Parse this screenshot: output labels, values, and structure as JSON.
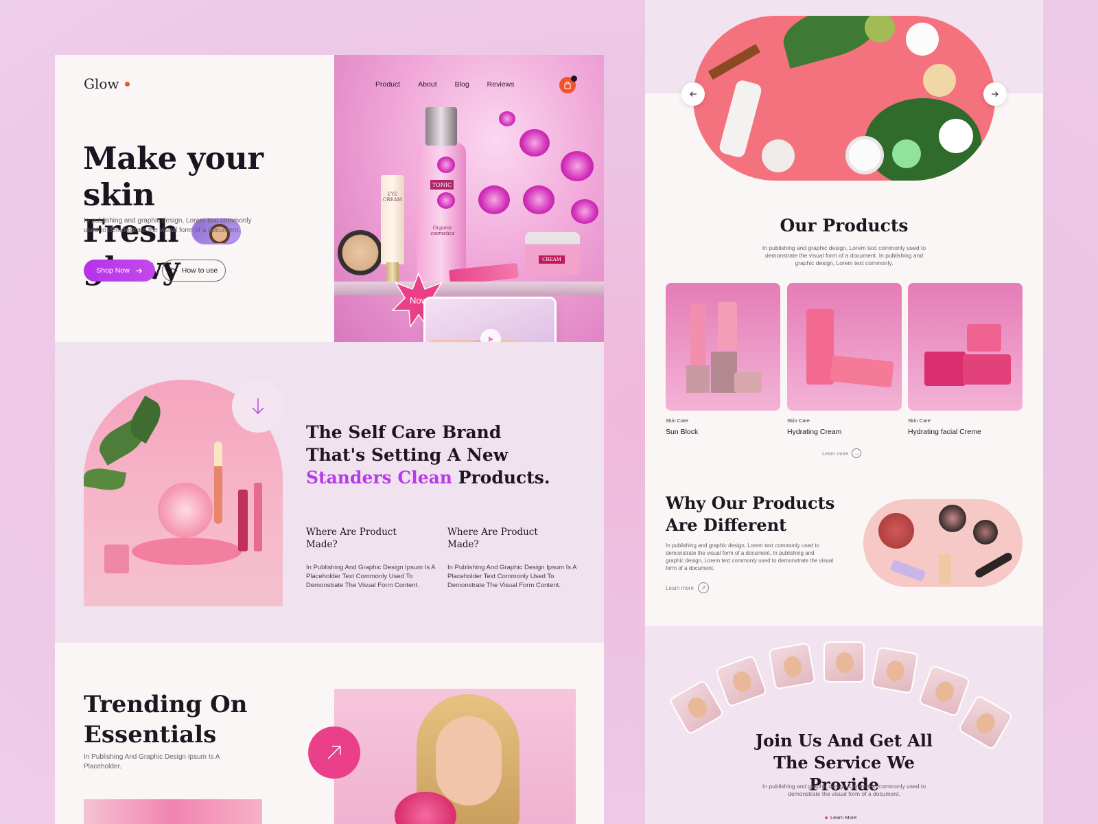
{
  "brand": {
    "name": "Glow"
  },
  "nav": {
    "items": [
      "Product",
      "About",
      "Blog",
      "Reviews"
    ],
    "cart_count": ""
  },
  "hero": {
    "title_line1": "Make your skin",
    "title_line2a": "Fresh",
    "title_line2b": "glowy",
    "description": "In publishing and graphic design, Lorem text commonly used to demonstrate the visual form of a document.",
    "shop_label": "Shop Now",
    "how_label": "How to use",
    "star_label": "Now",
    "product_labels": {
      "tonic": "TONIC",
      "eye_cream": "EYE CREAM",
      "cream": "CREAM",
      "organic": "Organic cosmetics"
    }
  },
  "selfcare": {
    "title_a": "The Self Care Brand That's Setting A New ",
    "title_accent": "Standers Clean",
    "title_b": " Products.",
    "columns": [
      {
        "heading": "Where Are Product Made?",
        "text": "In Publishing And Graphic Design Ipsum Is A Placeholder Text Commonly Used To Demonstrate The Visual Form Content."
      },
      {
        "heading": "Where Are Product Made?",
        "text": "In Publishing And Graphic Design Ipsum Is A Placeholder Text Commonly Used To Demonstrate The Visual Form Content."
      }
    ]
  },
  "trending": {
    "title": "Trending On Essentials",
    "description": "In Publishing And Graphic Design Ipsum Is A Placeholder."
  },
  "products": {
    "title": "Our Products",
    "description": "In publishing and graphic design, Lorem text commonly used to demonstrate the visual form of a document. In publishing and graphic design, Lorem text commonly.",
    "items": [
      {
        "category": "Skin Care",
        "name": "Sun Block"
      },
      {
        "category": "Skin Care",
        "name": "Hydrating Cream"
      },
      {
        "category": "Skin Care",
        "name": "Hydrating facial Creme"
      }
    ],
    "learn_more": "Learn more"
  },
  "why": {
    "title": "Why Our Products Are Different",
    "description": "In publishing and graphic design, Lorem text commonly used to demonstrate the visual form of a document. In publishing and graphic design, Lorem text commonly used to demonstrate the visual form of a document.",
    "learn_more": "Learn more"
  },
  "join": {
    "title": "Join Us And Get All The Service We Provide",
    "description": "In publishing and graphic design, Lorem text commonly used to demonstrate the visual form of a document.",
    "learn_more": "Learn More"
  },
  "colors": {
    "accent": "#b83ae8",
    "brand_dot": "#f2552c",
    "pink": "#ec3f8a"
  }
}
